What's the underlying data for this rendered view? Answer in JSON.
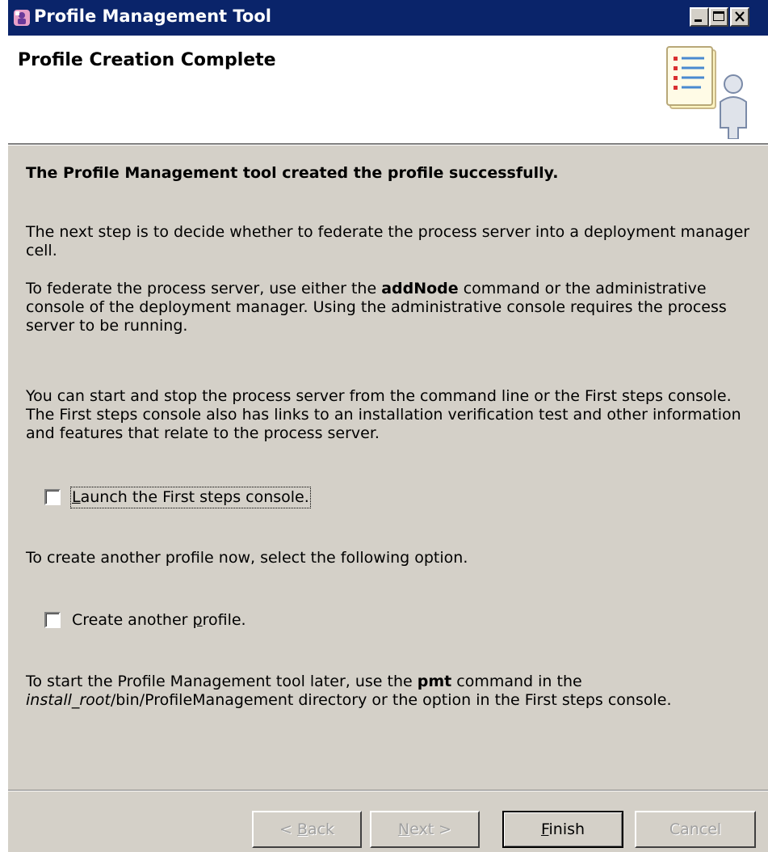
{
  "window": {
    "title": "Profile Management Tool"
  },
  "banner": {
    "title": "Profile Creation Complete",
    "icon": "checklist-person-graphic"
  },
  "content": {
    "headline": "The Profile Management tool created the profile successfully.",
    "p1": "The next step is to decide whether to federate the process server into a deployment manager cell.",
    "p2_before": "To federate the process server, use either the ",
    "p2_cmd": "addNode",
    "p2_after": " command or the administrative console of the deployment manager. Using the administrative console requires the process server to be running.",
    "p3": "You can start and stop the process server from the command line or the First steps console. The First steps console also has links to an installation verification test and other information and features that relate to the process server.",
    "checkbox_first_steps": {
      "label_pre": "",
      "label_mnemonic": "L",
      "label_post": "aunch the First steps console.",
      "checked": false
    },
    "p4": "To create another profile now, select the following option.",
    "checkbox_another": {
      "label_pre": "Create another ",
      "label_mnemonic": "p",
      "label_post": "rofile.",
      "checked": false
    },
    "p5_before": "To start the Profile Management tool later, use the ",
    "p5_cmd": "pmt",
    "p5_mid": " command in the ",
    "p5_italic": "install_root",
    "p5_after": "/bin/ProfileManagement directory or the option in the First steps console."
  },
  "buttons": {
    "back": {
      "pre": "< ",
      "mnemonic": "B",
      "post": "ack",
      "enabled": false
    },
    "next": {
      "pre": "",
      "mnemonic": "N",
      "post": "ext >",
      "enabled": false
    },
    "finish": {
      "pre": "",
      "mnemonic": "F",
      "post": "inish",
      "enabled": true
    },
    "cancel": {
      "label": "Cancel",
      "enabled": false
    }
  },
  "colors": {
    "titlebar": "#0a246a",
    "dialog": "#d4d0c8",
    "disabled_text": "#a0a0a0"
  }
}
